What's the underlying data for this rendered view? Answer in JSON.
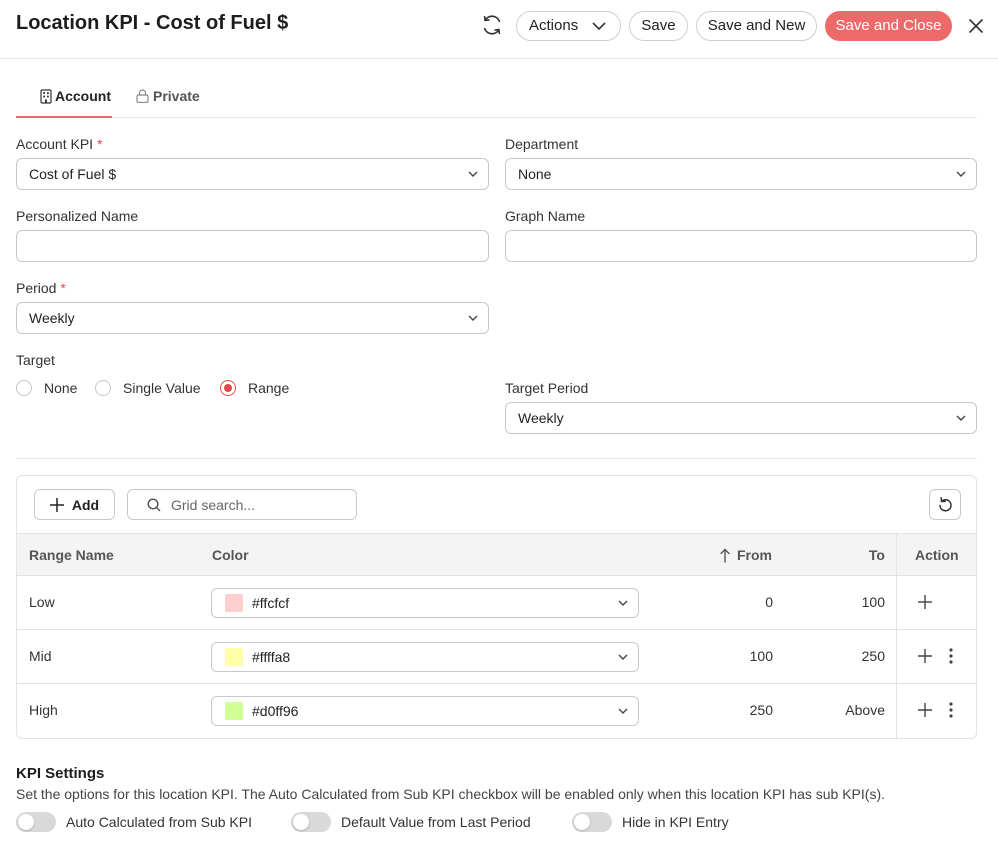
{
  "header": {
    "title": "Location KPI - Cost of Fuel $",
    "actions_label": "Actions",
    "save_label": "Save",
    "save_new_label": "Save and New",
    "save_close_label": "Save and Close",
    "accent_color": "#ee6a6a"
  },
  "tabs": [
    {
      "label": "Account",
      "icon": "building-icon",
      "active": true
    },
    {
      "label": "Private",
      "icon": "lock-icon",
      "active": false
    }
  ],
  "form": {
    "account_kpi": {
      "label": "Account KPI",
      "required_mark": "*",
      "value": "Cost of Fuel $"
    },
    "department": {
      "label": "Department",
      "value": "None"
    },
    "personalized_name": {
      "label": "Personalized Name",
      "value": ""
    },
    "graph_name": {
      "label": "Graph Name",
      "value": ""
    },
    "period": {
      "label": "Period",
      "required_mark": "*",
      "value": "Weekly"
    },
    "target": {
      "label": "Target",
      "options": [
        "None",
        "Single Value",
        "Range"
      ],
      "selected": "Range"
    },
    "target_period": {
      "label": "Target Period",
      "value": "Weekly"
    }
  },
  "grid": {
    "add_label": "Add",
    "search_placeholder": "Grid search...",
    "columns": {
      "range_name": "Range Name",
      "color": "Color",
      "from": "From",
      "to": "To",
      "action": "Action"
    },
    "sort": {
      "column": "From",
      "direction": "ascending"
    },
    "rows": [
      {
        "range_name": "Low",
        "color": "#ffcfcf",
        "from": "0",
        "to": "100"
      },
      {
        "range_name": "Mid",
        "color": "#ffffa8",
        "from": "100",
        "to": "250"
      },
      {
        "range_name": "High",
        "color": "#d0ff96",
        "from": "250",
        "to": "Above"
      }
    ]
  },
  "kpi_settings": {
    "title": "KPI Settings",
    "description": "Set the options for this location KPI. The Auto Calculated from Sub KPI checkbox will be enabled only when this location KPI has sub KPI(s).",
    "toggles": [
      {
        "label": "Auto Calculated from Sub KPI",
        "on": false
      },
      {
        "label": "Default Value from Last Period",
        "on": false
      },
      {
        "label": "Hide in KPI Entry",
        "on": false
      }
    ]
  }
}
